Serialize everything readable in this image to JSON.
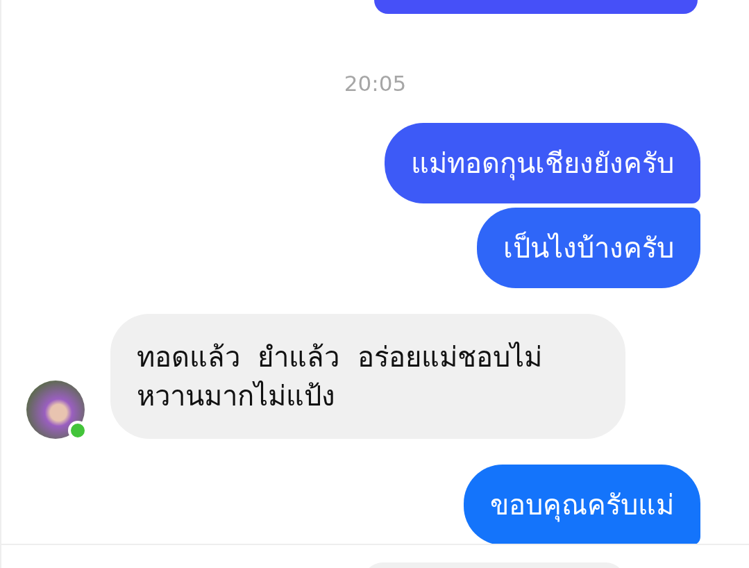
{
  "messages": [
    {
      "kind": "timestamp",
      "text": "20:05"
    },
    {
      "kind": "outgoing",
      "text": "แม่ทอดกุนเชียงยังครับ"
    },
    {
      "kind": "outgoing",
      "text": "เป็นไงบ้างครับ"
    },
    {
      "kind": "incoming",
      "text": "ทอดแล้ว  ยำแล้ว  อร่อยแม่ชอบไม่หวานมากไม่แป้ง",
      "online": true
    },
    {
      "kind": "outgoing",
      "text": "ขอบคุณครับแม่"
    }
  ]
}
